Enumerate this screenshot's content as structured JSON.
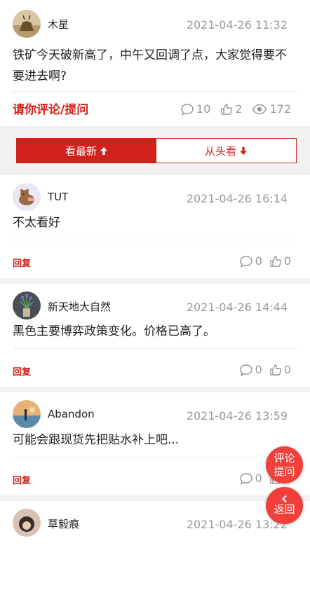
{
  "post": {
    "author": "木星",
    "time": "2021-04-26 11:32",
    "content": "铁矿今天破新高了，中午又回调了点，大家觉得要不要进去啊?",
    "ask_label": "请你评论/提问",
    "comments": "10",
    "likes": "2",
    "views": "172"
  },
  "sort": {
    "newest_label": "看最新",
    "oldest_label": "从头看"
  },
  "replies": [
    {
      "author": "TUT",
      "time": "2021-04-26 16:14",
      "content": "不太看好",
      "reply_label": "回复",
      "comments": "0",
      "likes": "0"
    },
    {
      "author": "新天地大自然",
      "time": "2021-04-26 14:44",
      "content": "黑色主要博弈政策变化。价格已高了。",
      "reply_label": "回复",
      "comments": "0",
      "likes": "0"
    },
    {
      "author": "Abandon",
      "time": "2021-04-26 13:59",
      "content": "可能会跟现货先把贴水补上吧...",
      "reply_label": "回复",
      "comments": "0",
      "likes": "0"
    },
    {
      "author": "草毅痕",
      "time": "2021-04-26 13:22"
    }
  ],
  "fab": {
    "comment_line1": "评论",
    "comment_line2": "提问",
    "back_label": "返回"
  },
  "colors": {
    "accent": "#d0211c",
    "fab": "#f1403a",
    "muted": "#999999"
  },
  "icons": [
    "comment-icon",
    "like-icon",
    "eye-icon",
    "arrow-up-icon",
    "arrow-down-icon",
    "chevron-left-icon"
  ]
}
